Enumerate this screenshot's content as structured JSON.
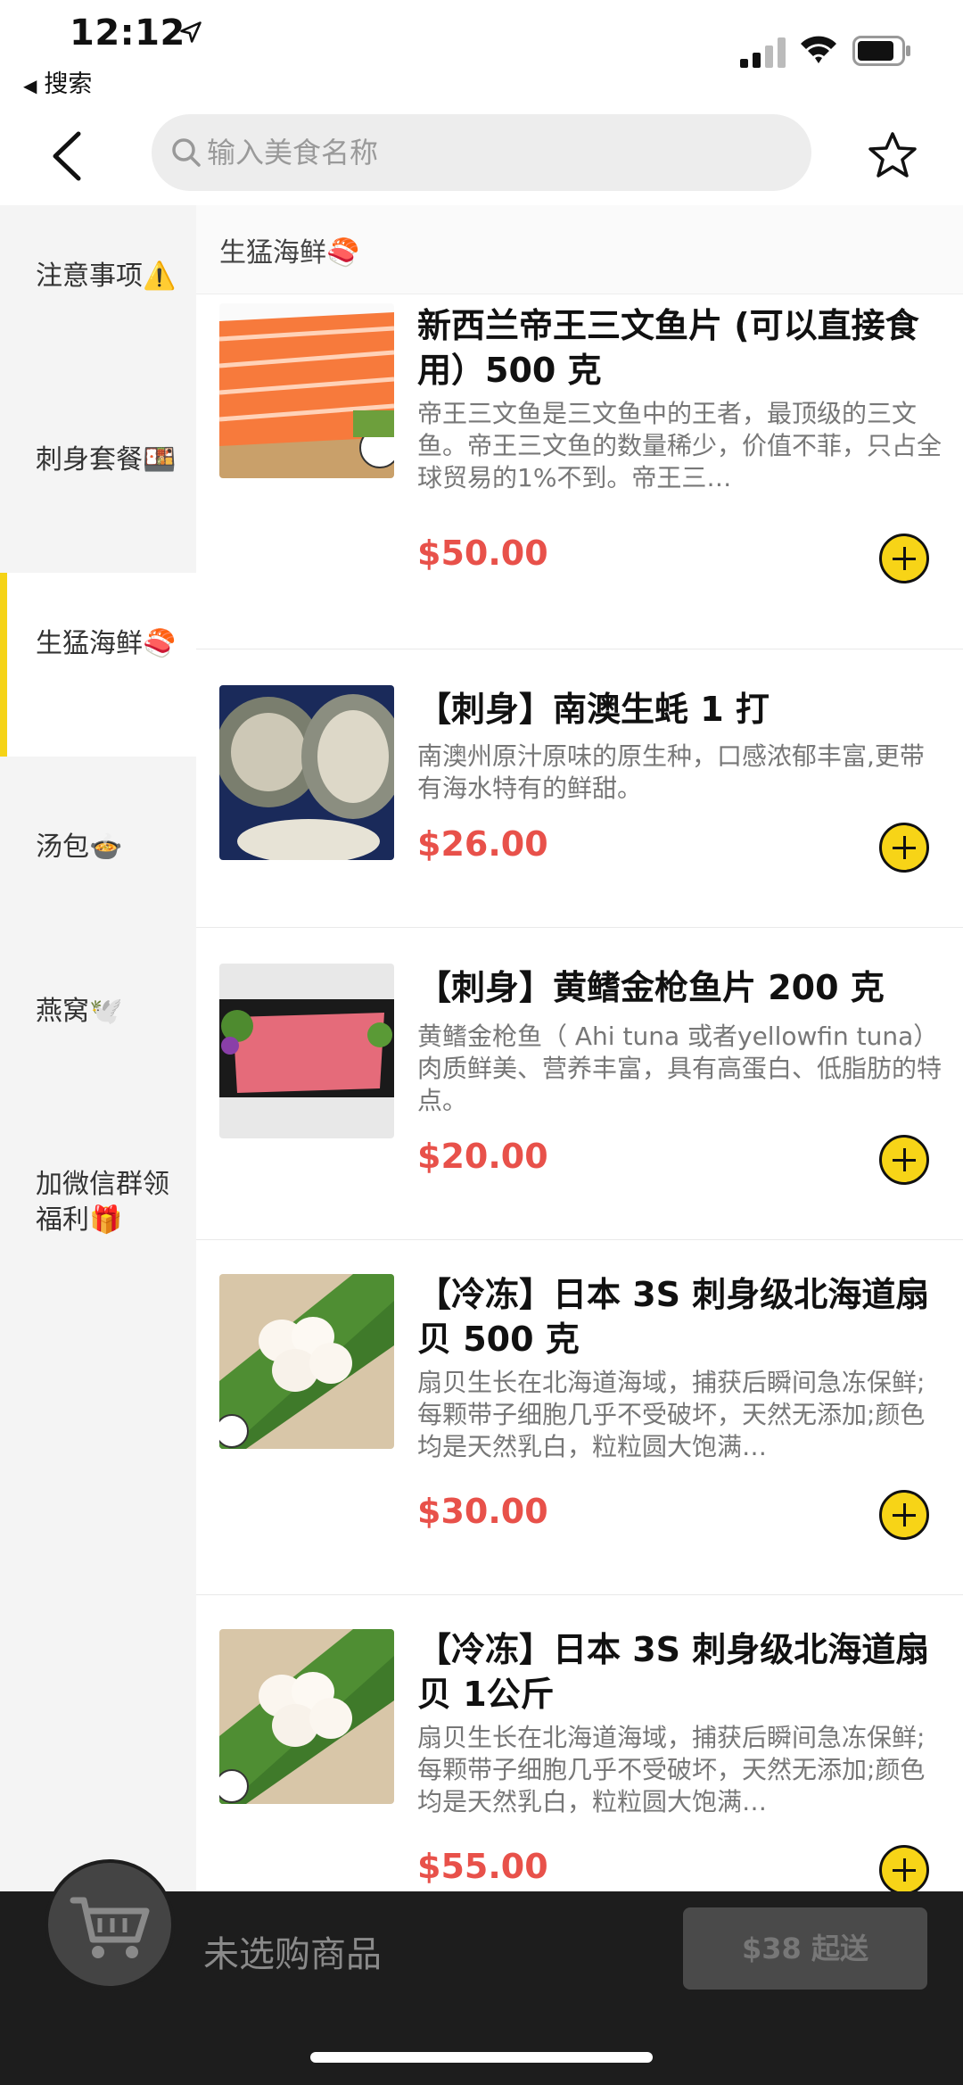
{
  "status_bar": {
    "time": "12:12",
    "back_label": "搜索"
  },
  "nav": {
    "search_placeholder": "输入美食名称"
  },
  "sidebar": {
    "items": [
      {
        "label": "注意事项⚠️",
        "active": false
      },
      {
        "label": "刺身套餐🍱",
        "active": false
      },
      {
        "label": "生猛海鲜🍣",
        "active": true
      },
      {
        "label": "汤包🍲",
        "active": false
      },
      {
        "label": "燕窝🕊️",
        "active": false
      },
      {
        "label": "加微信群领福利🎁",
        "active": false
      }
    ]
  },
  "section": {
    "title": "生猛海鲜🍣"
  },
  "products": [
    {
      "title": "新西兰帝王三文鱼片 (可以直接食用）500 克",
      "description": "帝王三文鱼是三文鱼中的王者，最顶级的三文鱼。帝王三文鱼的数量稀少，价值不菲，只占全球贸易的1%不到。帝王三…",
      "price": "$50.00",
      "image": "salmon"
    },
    {
      "title": "【刺身】南澳生蚝 1 打",
      "description": "南澳州原汁原味的原生种，口感浓郁丰富,更带有海水特有的鲜甜。",
      "price": "$26.00",
      "image": "oyster"
    },
    {
      "title": "【刺身】黄鳍金枪鱼片 200 克",
      "description": "黄鳍金枪鱼（ Ahi tuna 或者yellowfin tuna）肉质鲜美、营养丰富，具有高蛋白、低脂肪的特点。",
      "price": "$20.00",
      "image": "tuna"
    },
    {
      "title": "【冷冻】日本 3S 刺身级北海道扇贝 500 克",
      "description": "扇贝生长在北海道海域，捕获后瞬间急冻保鲜;每颗带子细胞几乎不受破坏，天然无添加;颜色均是天然乳白，粒粒圆大饱满…",
      "price": "$30.00",
      "image": "scallop"
    },
    {
      "title": "【冷冻】日本 3S 刺身级北海道扇贝 1公斤",
      "description": "扇贝生长在北海道海域，捕获后瞬间急冻保鲜;每颗带子细胞几乎不受破坏，天然无添加;颜色均是天然乳白，粒粒圆大饱满…",
      "price": "$55.00",
      "image": "scallop"
    }
  ],
  "cart": {
    "empty_text": "未选购商品",
    "min_order": "$38 起送"
  },
  "colors": {
    "accent_yellow": "#f7d417",
    "price_red": "#e8514a",
    "cart_bar": "#1d1d1d"
  }
}
